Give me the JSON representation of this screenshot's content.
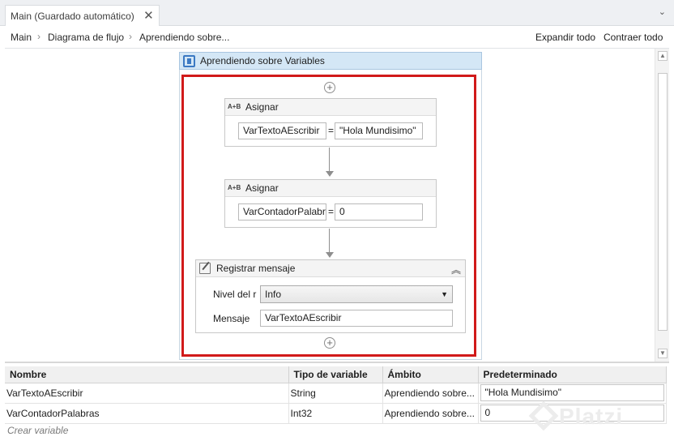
{
  "tab": {
    "title": "Main (Guardado automático)",
    "close": "✕",
    "menu": "⌄"
  },
  "breadcrumb": [
    "Main",
    "Diagrama de flujo",
    "Aprendiendo sobre..."
  ],
  "toolbar": {
    "expand": "Expandir todo",
    "collapse": "Contraer todo"
  },
  "sequence": {
    "title": "Aprendiendo sobre Variables",
    "add": "+"
  },
  "assign1": {
    "title": "Asignar",
    "icon": "A+B",
    "to": "VarTextoAEscribir",
    "equals": "=",
    "value": "\"Hola Mundisimo\""
  },
  "assign2": {
    "title": "Asignar",
    "icon": "A+B",
    "to": "VarContadorPalabr",
    "equals": "=",
    "value": "0"
  },
  "log": {
    "title": "Registrar mensaje",
    "level_label": "Nivel del r",
    "level_value": "Info",
    "message_label": "Mensaje",
    "message_value": "VarTextoAEscribir",
    "collapse_icon": "︽"
  },
  "variables": {
    "headers": [
      "Nombre",
      "Tipo de variable",
      "Ámbito",
      "Predeterminado"
    ],
    "rows": [
      {
        "name": "VarTextoAEscribir",
        "type": "String",
        "scope": "Aprendiendo sobre...",
        "default": "\"Hola Mundisimo\""
      },
      {
        "name": "VarContadorPalabras",
        "type": "Int32",
        "scope": "Aprendiendo sobre...",
        "default": "0"
      }
    ],
    "create": "Crear variable"
  },
  "watermark": "Platzi",
  "colors": {
    "highlight": "#d11a1a",
    "sequence_header": "#d4e7f6",
    "accent": "#3b79c3"
  }
}
